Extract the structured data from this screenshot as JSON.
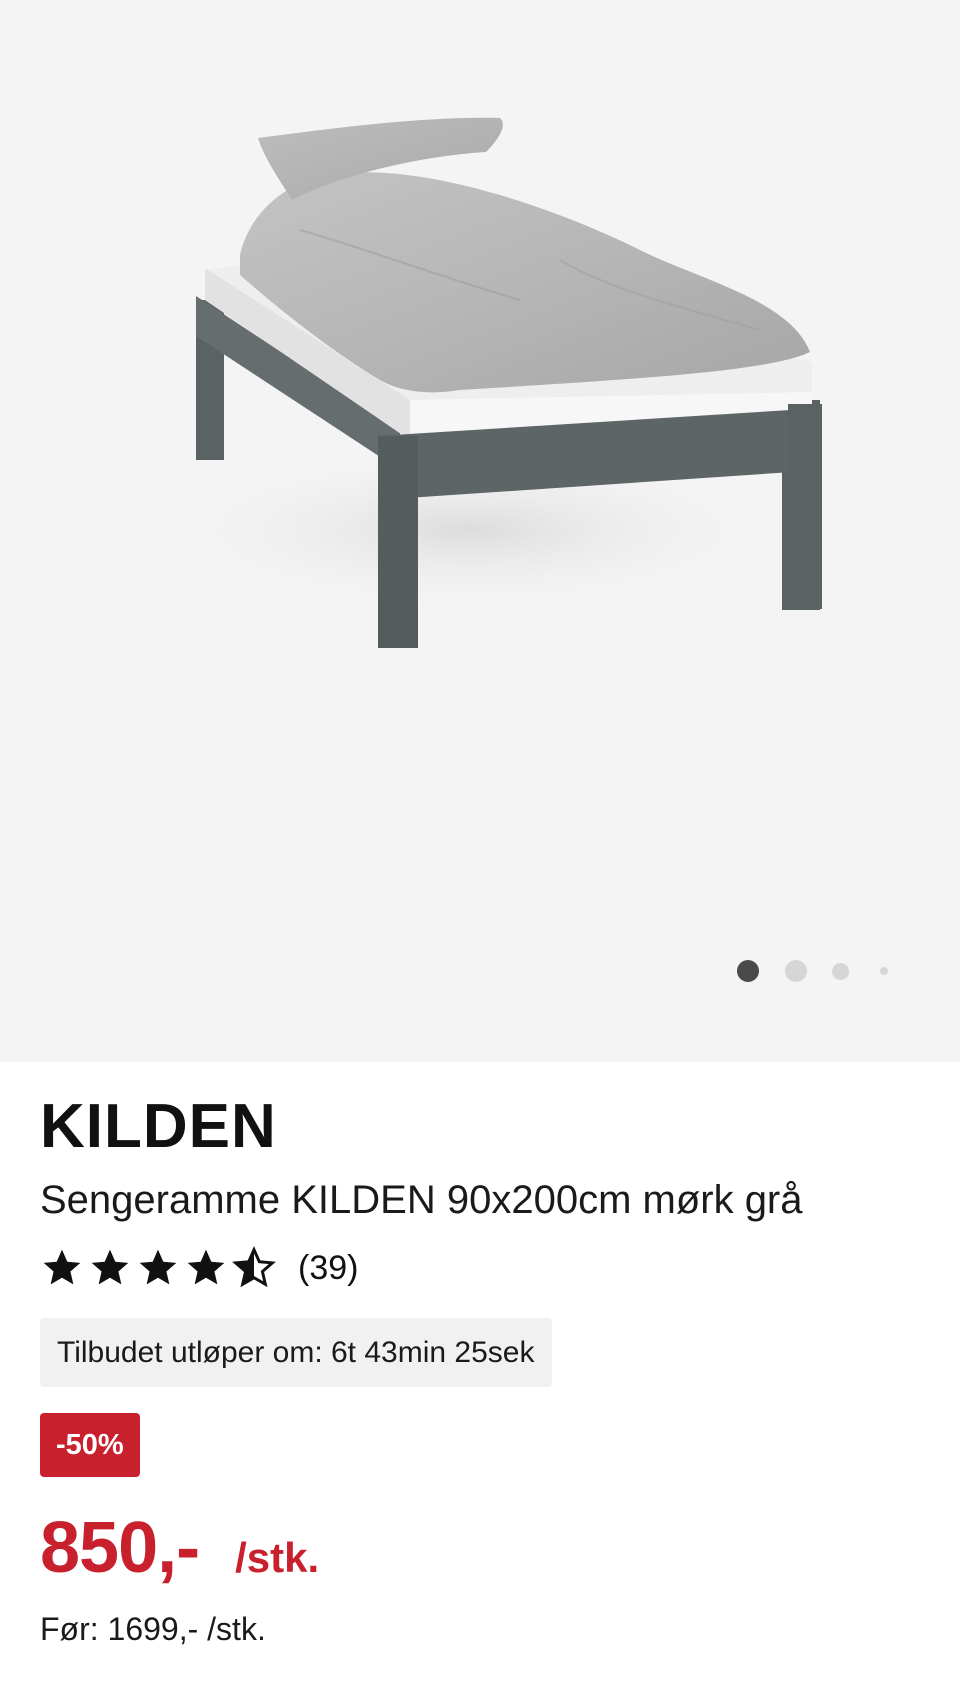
{
  "product": {
    "image_alt": "bed-frame-photo",
    "carousel": {
      "slide_count": 4,
      "active_index": 0
    },
    "brand": "KILDEN",
    "title": "Sengeramme KILDEN 90x200cm mørk grå",
    "rating": {
      "stars": 4.5,
      "max": 5,
      "count_label": "(39)"
    },
    "countdown": "Tilbudet utløper om: 6t 43min 25sek",
    "discount_badge": "-50%",
    "price": "850,-",
    "price_unit": "/stk.",
    "old_price": "Før: 1699,- /stk."
  },
  "colors": {
    "accent_red": "#c8202d",
    "image_background": "#f4f4f4",
    "frame_gray": "#5e6566",
    "duvet_gray": "#b3b3b3"
  }
}
